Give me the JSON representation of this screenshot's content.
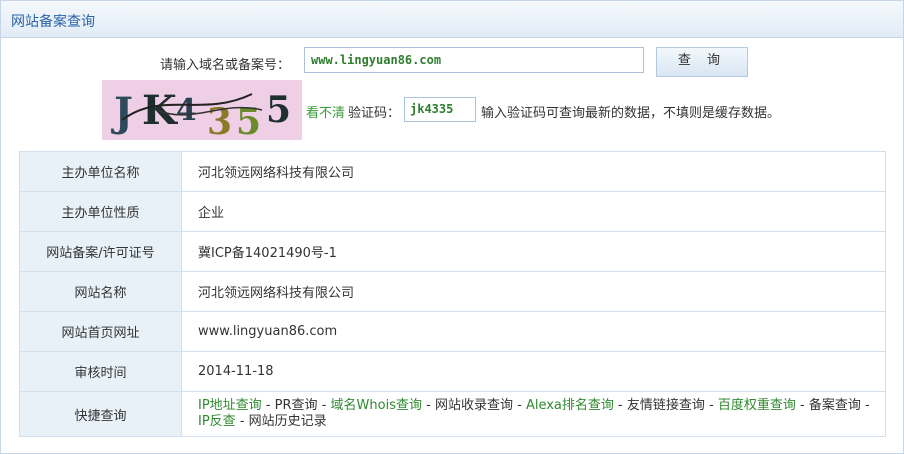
{
  "panel": {
    "title": "网站备案查询"
  },
  "search": {
    "label": "请输入域名或备案号：",
    "value": "www.lingyuan86.com",
    "button_label": "查 询"
  },
  "captcha": {
    "image_text": "JK4355",
    "link_text": "看不清",
    "label": "验证码：",
    "value": "jk4335",
    "hint": "输入验证码可查询最新的数据，不填则是缓存数据。"
  },
  "info": {
    "rows": [
      {
        "key": "主办单位名称",
        "value": "河北领远网络科技有限公司"
      },
      {
        "key": "主办单位性质",
        "value": "企业"
      },
      {
        "key": "网站备案/许可证号",
        "value": "冀ICP备14021490号-1"
      },
      {
        "key": "网站名称",
        "value": "河北领远网络科技有限公司"
      },
      {
        "key": "网站首页网址",
        "value": "www.lingyuan86.com"
      },
      {
        "key": "审核时间",
        "value": "2014-11-18"
      }
    ],
    "quick": {
      "key": "快捷查询",
      "separator": "-",
      "links": [
        "IP地址查询",
        "PR查询",
        "域名Whois查询",
        "网站收录查询",
        "Alexa排名查询",
        "友情链接查询",
        "百度权重查询",
        "备案查询",
        "IP反查",
        "网站历史记录"
      ]
    }
  },
  "colors": {
    "link_green": "#2f8a2f",
    "title_blue": "#2a63a8",
    "key_cell_bg": "#e8f1f8"
  }
}
